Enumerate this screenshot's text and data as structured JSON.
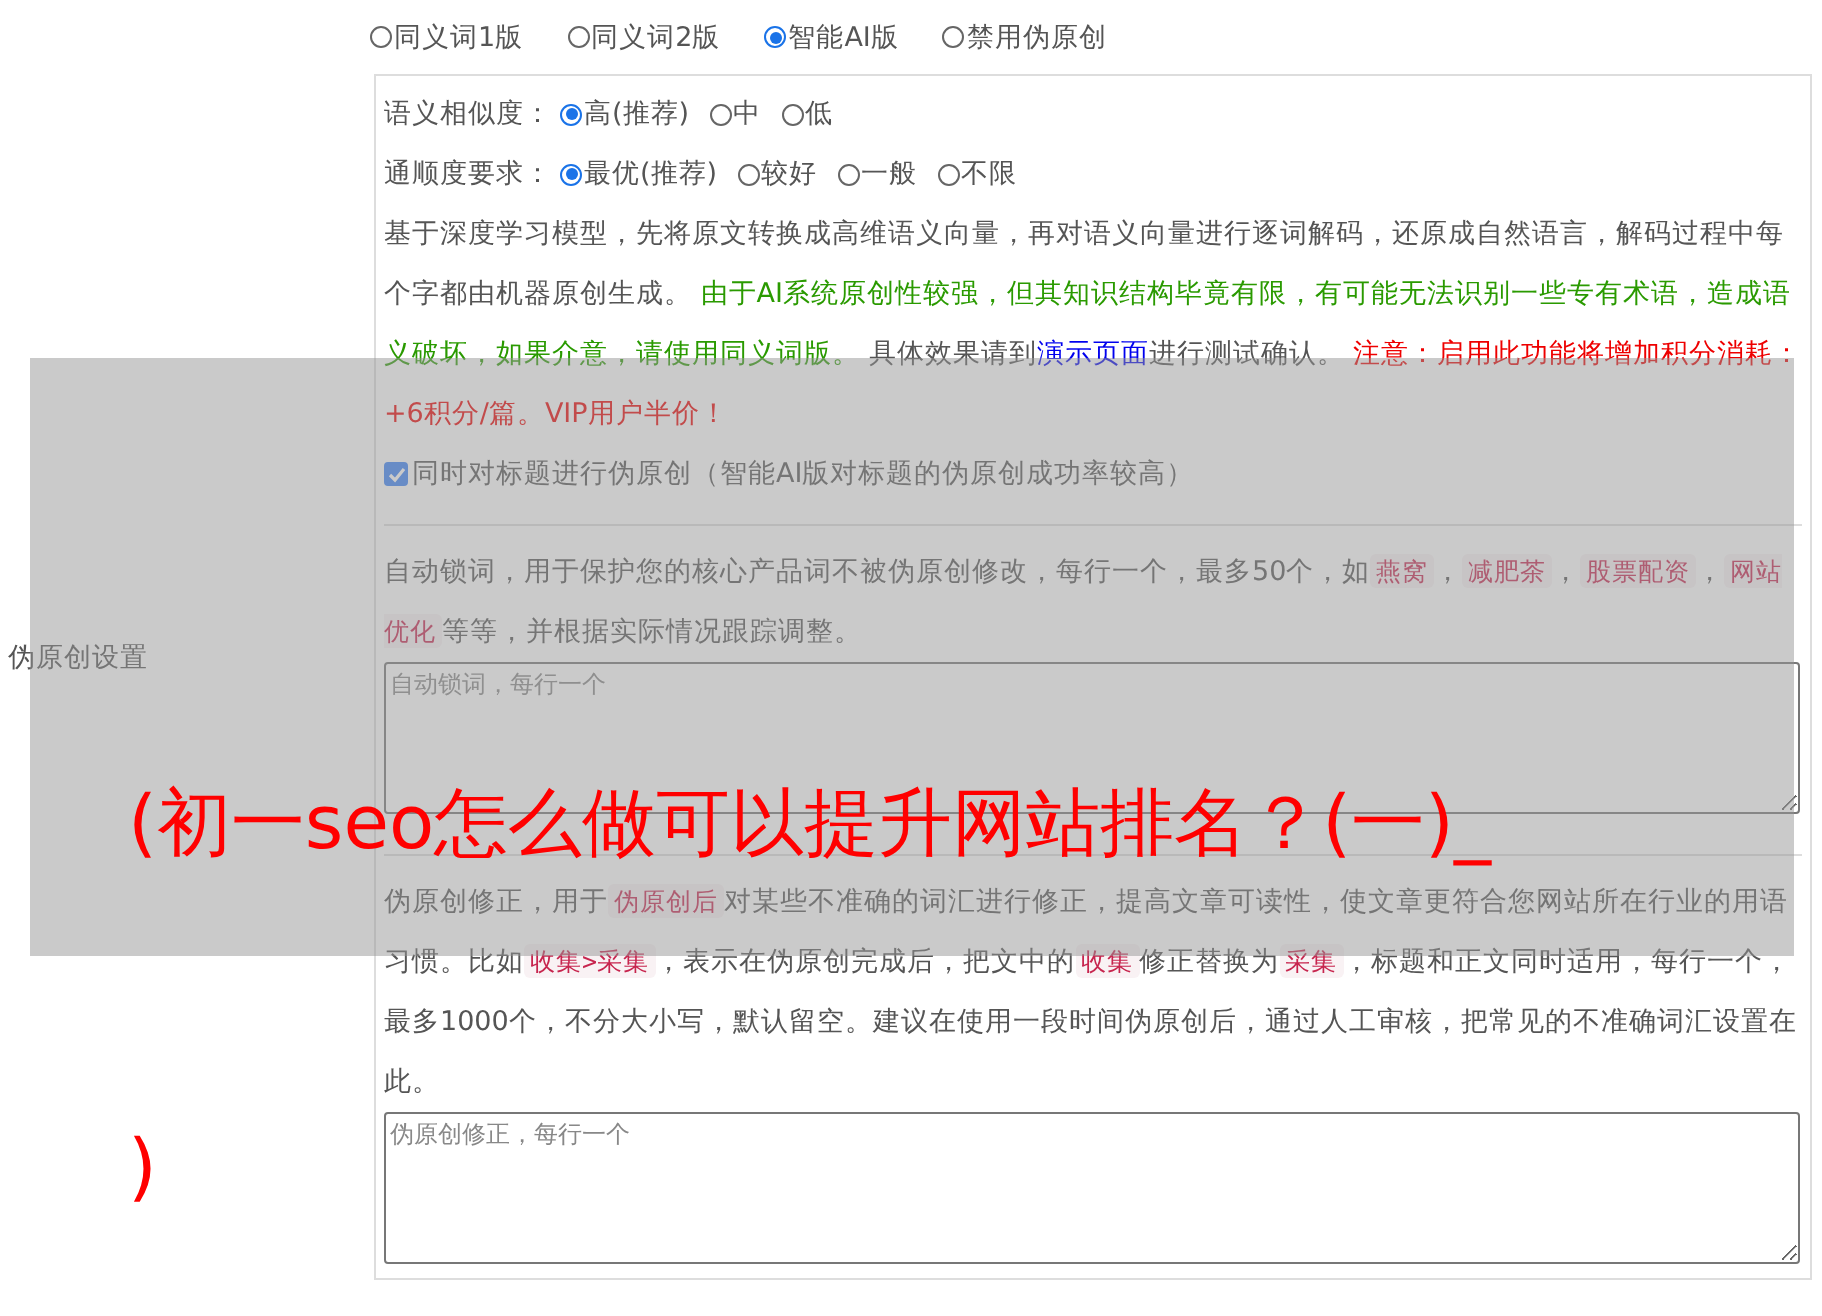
{
  "mode_options": [
    {
      "label": "同义词1版",
      "selected": false
    },
    {
      "label": "同义词2版",
      "selected": false
    },
    {
      "label": "智能AI版",
      "selected": true
    },
    {
      "label": "禁用伪原创",
      "selected": false
    }
  ],
  "setting_label": "伪原创设置",
  "similarity": {
    "label": "语义相似度：",
    "options": [
      {
        "label": "高(推荐)",
        "selected": true
      },
      {
        "label": "中",
        "selected": false
      },
      {
        "label": "低",
        "selected": false
      }
    ]
  },
  "fluency": {
    "label": "通顺度要求：",
    "options": [
      {
        "label": "最优(推荐)",
        "selected": true
      },
      {
        "label": "较好",
        "selected": false
      },
      {
        "label": "一般",
        "selected": false
      },
      {
        "label": "不限",
        "selected": false
      }
    ]
  },
  "ai_description": [
    {
      "kind": "plain",
      "text": "基于深度学习模型，先将原文转换成高维语义向量，再对语义向量进行逐词解码，还原成自然语言，解码过程中每个字都由机器原创生成。 "
    },
    {
      "kind": "green",
      "text": "由于AI系统原创性较强，但其知识结构毕竟有限，有可能无法识别一些专有术语，造成语义破坏，如果介意，请使用同义词版。"
    },
    {
      "kind": "plain",
      "text": " 具体效果请到"
    },
    {
      "kind": "link",
      "text": "演示页面"
    },
    {
      "kind": "plain",
      "text": "进行测试确认。 "
    },
    {
      "kind": "red",
      "text": "注意：启用此功能将增加积分消耗：+6积分/篇。VIP用户半价！"
    }
  ],
  "title_checkbox": {
    "label": "同时对标题进行伪原创（智能AI版对标题的伪原创成功率较高）",
    "checked": true
  },
  "lock_words": {
    "description": [
      {
        "kind": "plain",
        "text": "自动锁词，用于保护您的核心产品词不被伪原创修改，每行一个，最多50个，如"
      },
      {
        "kind": "code",
        "text": "燕窝"
      },
      {
        "kind": "plain",
        "text": "，"
      },
      {
        "kind": "code",
        "text": "减肥茶"
      },
      {
        "kind": "plain",
        "text": "，"
      },
      {
        "kind": "code",
        "text": "股票配资"
      },
      {
        "kind": "plain",
        "text": "，"
      },
      {
        "kind": "code",
        "text": "网站优化"
      },
      {
        "kind": "plain",
        "text": "等等，并根据实际情况跟踪调整。"
      }
    ],
    "placeholder": "自动锁词，每行一个"
  },
  "corrections": {
    "description": [
      {
        "kind": "plain",
        "text": "伪原创修正，用于"
      },
      {
        "kind": "code",
        "text": "伪原创后"
      },
      {
        "kind": "plain",
        "text": "对某些不准确的词汇进行修正，提高文章可读性，使文章更符合您网站所在行业的用语习惯。比如"
      },
      {
        "kind": "code",
        "text": "收集>采集"
      },
      {
        "kind": "plain",
        "text": "，表示在伪原创完成后，把文中的"
      },
      {
        "kind": "code",
        "text": "收集"
      },
      {
        "kind": "plain",
        "text": "修正替换为"
      },
      {
        "kind": "code",
        "text": "采集"
      },
      {
        "kind": "plain",
        "text": "，标题和正文同时适用，每行一个，最多1000个，不分大小写，默认留空。建议在使用一段时间伪原创后，通过人工审核，把常见的不准确词汇设置在此。"
      }
    ],
    "placeholder": "伪原创修正，每行一个"
  },
  "overlay_title_lines": [
    "(初一seo怎么做可以提升网站排名？(一)_",
    ")"
  ]
}
